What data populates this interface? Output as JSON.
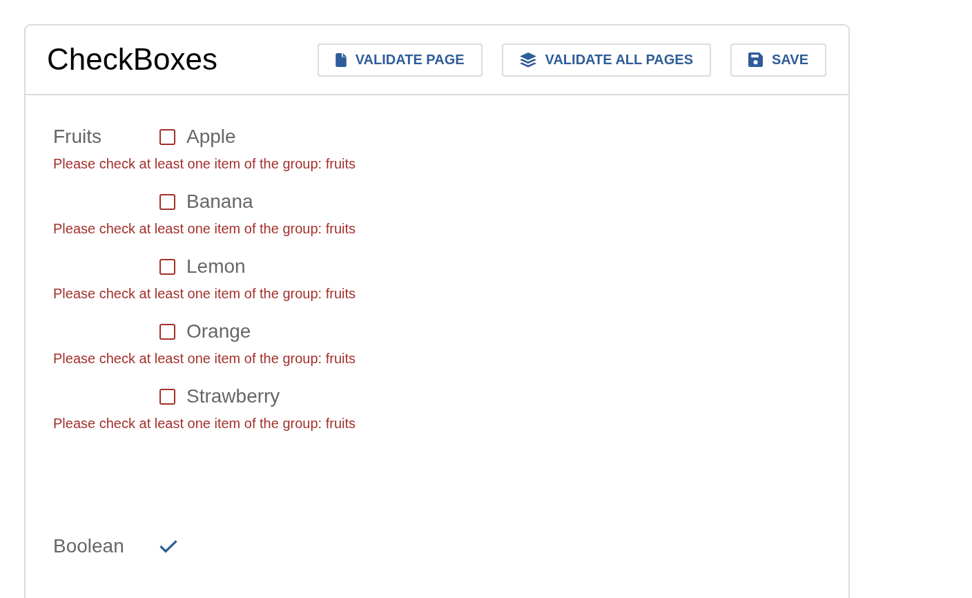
{
  "title": "CheckBoxes",
  "buttons": [
    {
      "kind": "page",
      "label": "VALIDATE PAGE"
    },
    {
      "kind": "all",
      "label": "VALIDATE ALL PAGES"
    },
    {
      "kind": "save",
      "label": "SAVE"
    }
  ],
  "fields": [
    {
      "kind": "group",
      "label": "Fruits",
      "options": [
        {
          "label": "Apple",
          "checked": false,
          "error": "Please check at least one item of the group: fruits"
        },
        {
          "label": "Banana",
          "checked": false,
          "error": "Please check at least one item of the group: fruits"
        },
        {
          "label": "Lemon",
          "checked": false,
          "error": "Please check at least one item of the group: fruits"
        },
        {
          "label": "Orange",
          "checked": false,
          "error": "Please check at least one item of the group: fruits"
        },
        {
          "label": "Strawberry",
          "checked": false,
          "error": "Please check at least one item of the group: fruits"
        }
      ]
    },
    {
      "kind": "boolean",
      "label": "Boolean",
      "checked": true
    }
  ]
}
